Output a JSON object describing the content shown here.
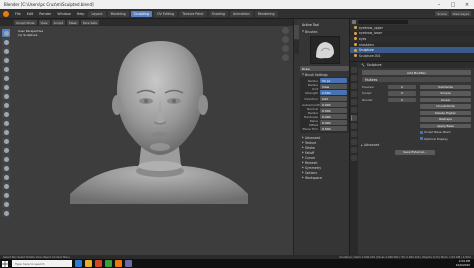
{
  "window": {
    "title": "Blender [C:\\Users\\pc Cruz\\m\\Sculpted.blend]"
  },
  "menubar": {
    "items": [
      "File",
      "Edit",
      "Render",
      "Window",
      "Help"
    ],
    "workspaces": [
      "Layout",
      "Modeling",
      "Sculpting",
      "UV Editing",
      "Texture Paint",
      "Shading",
      "Animation",
      "Rendering",
      "Compositing",
      "Scripting"
    ],
    "active_workspace": "Sculpting",
    "scene": "Scene",
    "view_layer": "View Layer"
  },
  "viewport": {
    "header": [
      "Sculpt Mode",
      "View",
      "Sculpt",
      "Mask",
      "Face Sets"
    ],
    "overlay_title": "User Perspective",
    "overlay_subtitle": "(1) Sculpture"
  },
  "tool_panel": {
    "title": "Active Tool",
    "brushes_label": "Brushes",
    "brush_name": "Draw",
    "brush_settings_label": "Brush Settings",
    "fields": [
      {
        "label": "Radius",
        "value": "50 px"
      },
      {
        "label": "Radius Unit",
        "value": "View"
      },
      {
        "label": "Strength",
        "value": "0.500"
      },
      {
        "label": "Direction",
        "value": "Add"
      },
      {
        "label": "Autosmooth",
        "value": "0.000"
      },
      {
        "label": "Normal Radius",
        "value": "0.500"
      },
      {
        "label": "Hardness",
        "value": "0.000"
      },
      {
        "label": "Plane Offset",
        "value": "0.000"
      },
      {
        "label": "Plane Trim",
        "value": "0.500"
      }
    ],
    "sections": [
      "Advanced",
      "Texture",
      "Stroke",
      "Falloff",
      "Cursor",
      "Remesh",
      "Symmetry",
      "Options",
      "Workspace"
    ]
  },
  "outliner": {
    "search_placeholder": "",
    "items": [
      {
        "name": "eyebrow_upper",
        "selected": false
      },
      {
        "name": "eyebrow_lower",
        "selected": false
      },
      {
        "name": "eyes",
        "selected": false
      },
      {
        "name": "shoulders",
        "selected": false
      },
      {
        "name": "Sculpture",
        "selected": true
      },
      {
        "name": "Sculpture.001",
        "selected": false
      },
      {
        "name": "Sculpture_mirror",
        "selected": false
      }
    ]
  },
  "properties": {
    "object_name": "Sculpture",
    "add_modifier": "Add Modifier",
    "modifier_name": "Multires",
    "rows": [
      {
        "label": "Preview",
        "value": "2",
        "button": "Subdivide"
      },
      {
        "label": "Sculpt",
        "value": "2",
        "button": "Simple"
      },
      {
        "label": "Render",
        "value": "2",
        "button": "Linear"
      }
    ],
    "buttons": [
      "Unsubdivide",
      "Delete Higher",
      "Reshape",
      "Apply Base"
    ],
    "checkboxes": [
      "Sculpt Base Mesh",
      "Optimal Display"
    ],
    "advanced": "Advanced",
    "save_external": "Save External..."
  },
  "statusbar": {
    "left": "Select  Box Select  Rotate View  Object Context Menu",
    "right": "Sculpture | Verts 1,046,210 | Faces 1,046,052 | Tris 2,092,104 | Objects 1/13 | Mem: 1.02 GiB | 2.90.0"
  },
  "taskbar": {
    "search_placeholder": "Type here to search",
    "time": "2:09 PM",
    "date": "10/6/2020"
  },
  "colors": {
    "accent": "#5680c2",
    "viewport_bg": "#3d3d3d",
    "model": "#9a9a9a"
  }
}
